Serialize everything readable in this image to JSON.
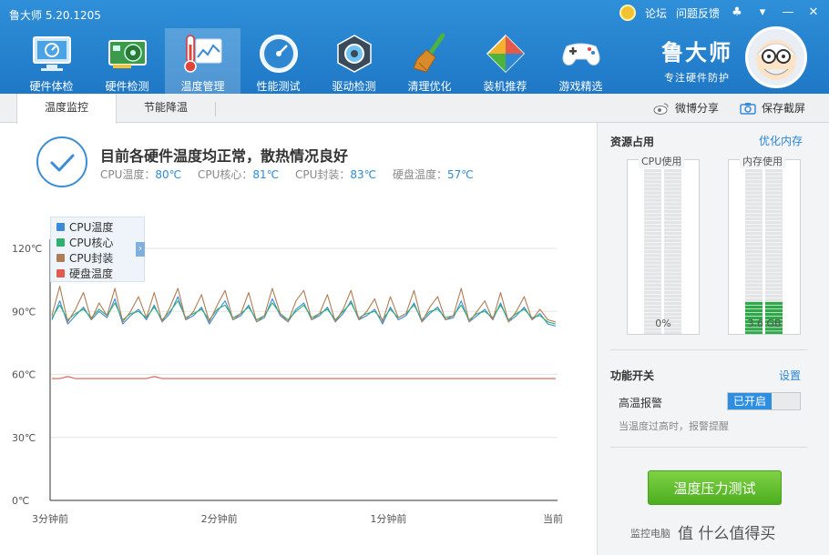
{
  "app": {
    "title": "鲁大师 5.20.1205",
    "top_links": {
      "forum": "论坛",
      "feedback": "问题反馈"
    }
  },
  "nav": {
    "items": [
      {
        "label": "硬件体检",
        "icon": "monitor-check-icon"
      },
      {
        "label": "硬件检测",
        "icon": "graphics-card-icon"
      },
      {
        "label": "温度管理",
        "icon": "thermometer-icon",
        "active": true
      },
      {
        "label": "性能测试",
        "icon": "speedometer-icon"
      },
      {
        "label": "驱动检测",
        "icon": "gear-box-icon"
      },
      {
        "label": "清理优化",
        "icon": "broom-icon"
      },
      {
        "label": "装机推荐",
        "icon": "cube-icon"
      },
      {
        "label": "游戏精选",
        "icon": "gamepad-icon"
      }
    ]
  },
  "brand": {
    "name": "鲁大师",
    "slogan": "专注硬件防护"
  },
  "tabs": {
    "items": [
      "温度监控",
      "节能降温"
    ],
    "active": 0
  },
  "share": {
    "weibo": "微博分享",
    "screenshot": "保存截屏"
  },
  "status": {
    "title": "目前各硬件温度均正常，散热情况良好",
    "readings": [
      {
        "label": "CPU温度：",
        "value": "80℃"
      },
      {
        "label": "CPU核心：",
        "value": "81℃"
      },
      {
        "label": "CPU封装：",
        "value": "83℃"
      },
      {
        "label": "硬盘温度：",
        "value": "57℃"
      }
    ]
  },
  "chart_data": {
    "type": "line",
    "ylim": [
      0,
      120
    ],
    "y_ticks": [
      "120℃",
      "90℃",
      "60℃",
      "30℃",
      "0℃"
    ],
    "x_ticks": [
      "3分钟前",
      "2分钟前",
      "1分钟前",
      "当前"
    ],
    "series": [
      {
        "name": "CPU温度",
        "color": "#3a8ad8",
        "values": [
          86,
          95,
          84,
          88,
          92,
          86,
          90,
          87,
          96,
          84,
          88,
          91,
          86,
          93,
          85,
          89,
          97,
          86,
          88,
          92,
          84,
          90,
          95,
          86,
          88,
          93,
          85,
          87,
          96,
          88,
          85,
          91,
          94,
          86,
          88,
          92,
          85,
          89,
          95,
          86,
          88,
          91,
          84,
          92,
          86,
          88,
          94,
          85,
          89,
          92,
          86,
          87,
          95,
          85,
          88,
          91,
          86,
          94,
          85,
          88,
          92,
          86,
          89,
          84,
          83
        ]
      },
      {
        "name": "CPU核心",
        "color": "#2fb06e",
        "values": [
          87,
          93,
          86,
          89,
          91,
          87,
          91,
          88,
          94,
          86,
          89,
          90,
          87,
          92,
          86,
          90,
          95,
          87,
          89,
          91,
          86,
          91,
          93,
          87,
          89,
          92,
          86,
          88,
          94,
          89,
          86,
          90,
          93,
          87,
          89,
          91,
          86,
          90,
          94,
          87,
          89,
          90,
          86,
          91,
          87,
          89,
          93,
          86,
          90,
          91,
          87,
          88,
          93,
          86,
          89,
          90,
          87,
          93,
          86,
          89,
          91,
          87,
          88,
          85,
          84
        ]
      },
      {
        "name": "CPU封装",
        "color": "#b07c55",
        "values": [
          88,
          102,
          85,
          91,
          99,
          86,
          94,
          88,
          101,
          85,
          90,
          97,
          87,
          99,
          85,
          92,
          101,
          86,
          90,
          98,
          85,
          93,
          100,
          86,
          89,
          99,
          85,
          88,
          101,
          89,
          85,
          95,
          100,
          86,
          89,
          98,
          85,
          91,
          100,
          86,
          90,
          96,
          85,
          97,
          87,
          89,
          100,
          85,
          92,
          97,
          86,
          88,
          101,
          85,
          90,
          95,
          86,
          99,
          85,
          90,
          97,
          86,
          91,
          86,
          85
        ]
      },
      {
        "name": "硬盘温度",
        "color": "#e05a4e",
        "values": [
          58,
          58,
          59,
          58,
          58,
          58,
          58,
          58,
          58,
          58,
          58,
          58,
          58,
          59,
          58,
          58,
          58,
          58,
          58,
          58,
          58,
          58,
          58,
          58,
          58,
          58,
          58,
          58,
          58,
          58,
          58,
          58,
          58,
          58,
          58,
          58,
          58,
          58,
          58,
          58,
          58,
          58,
          58,
          58,
          58,
          58,
          58,
          58,
          58,
          58,
          58,
          58,
          58,
          58,
          58,
          58,
          58,
          58,
          58,
          58,
          58,
          58,
          58,
          58,
          58
        ]
      }
    ]
  },
  "resources": {
    "title": "资源占用",
    "optimize_link": "优化内存",
    "cpu": {
      "label": "CPU使用",
      "value": "0%",
      "fraction": 0.0
    },
    "memory": {
      "label": "内存使用",
      "value": "3.6 GB",
      "fraction": 0.22
    }
  },
  "features": {
    "title": "功能开关",
    "settings_link": "设置",
    "alarm_label": "高温报警",
    "alarm_state": "已开启",
    "alarm_desc": "当温度过高时，报警提醒"
  },
  "stress_button": "温度压力测试",
  "footer": {
    "monitor_text": "监控电脑",
    "watermark": "值 什么值得买"
  }
}
